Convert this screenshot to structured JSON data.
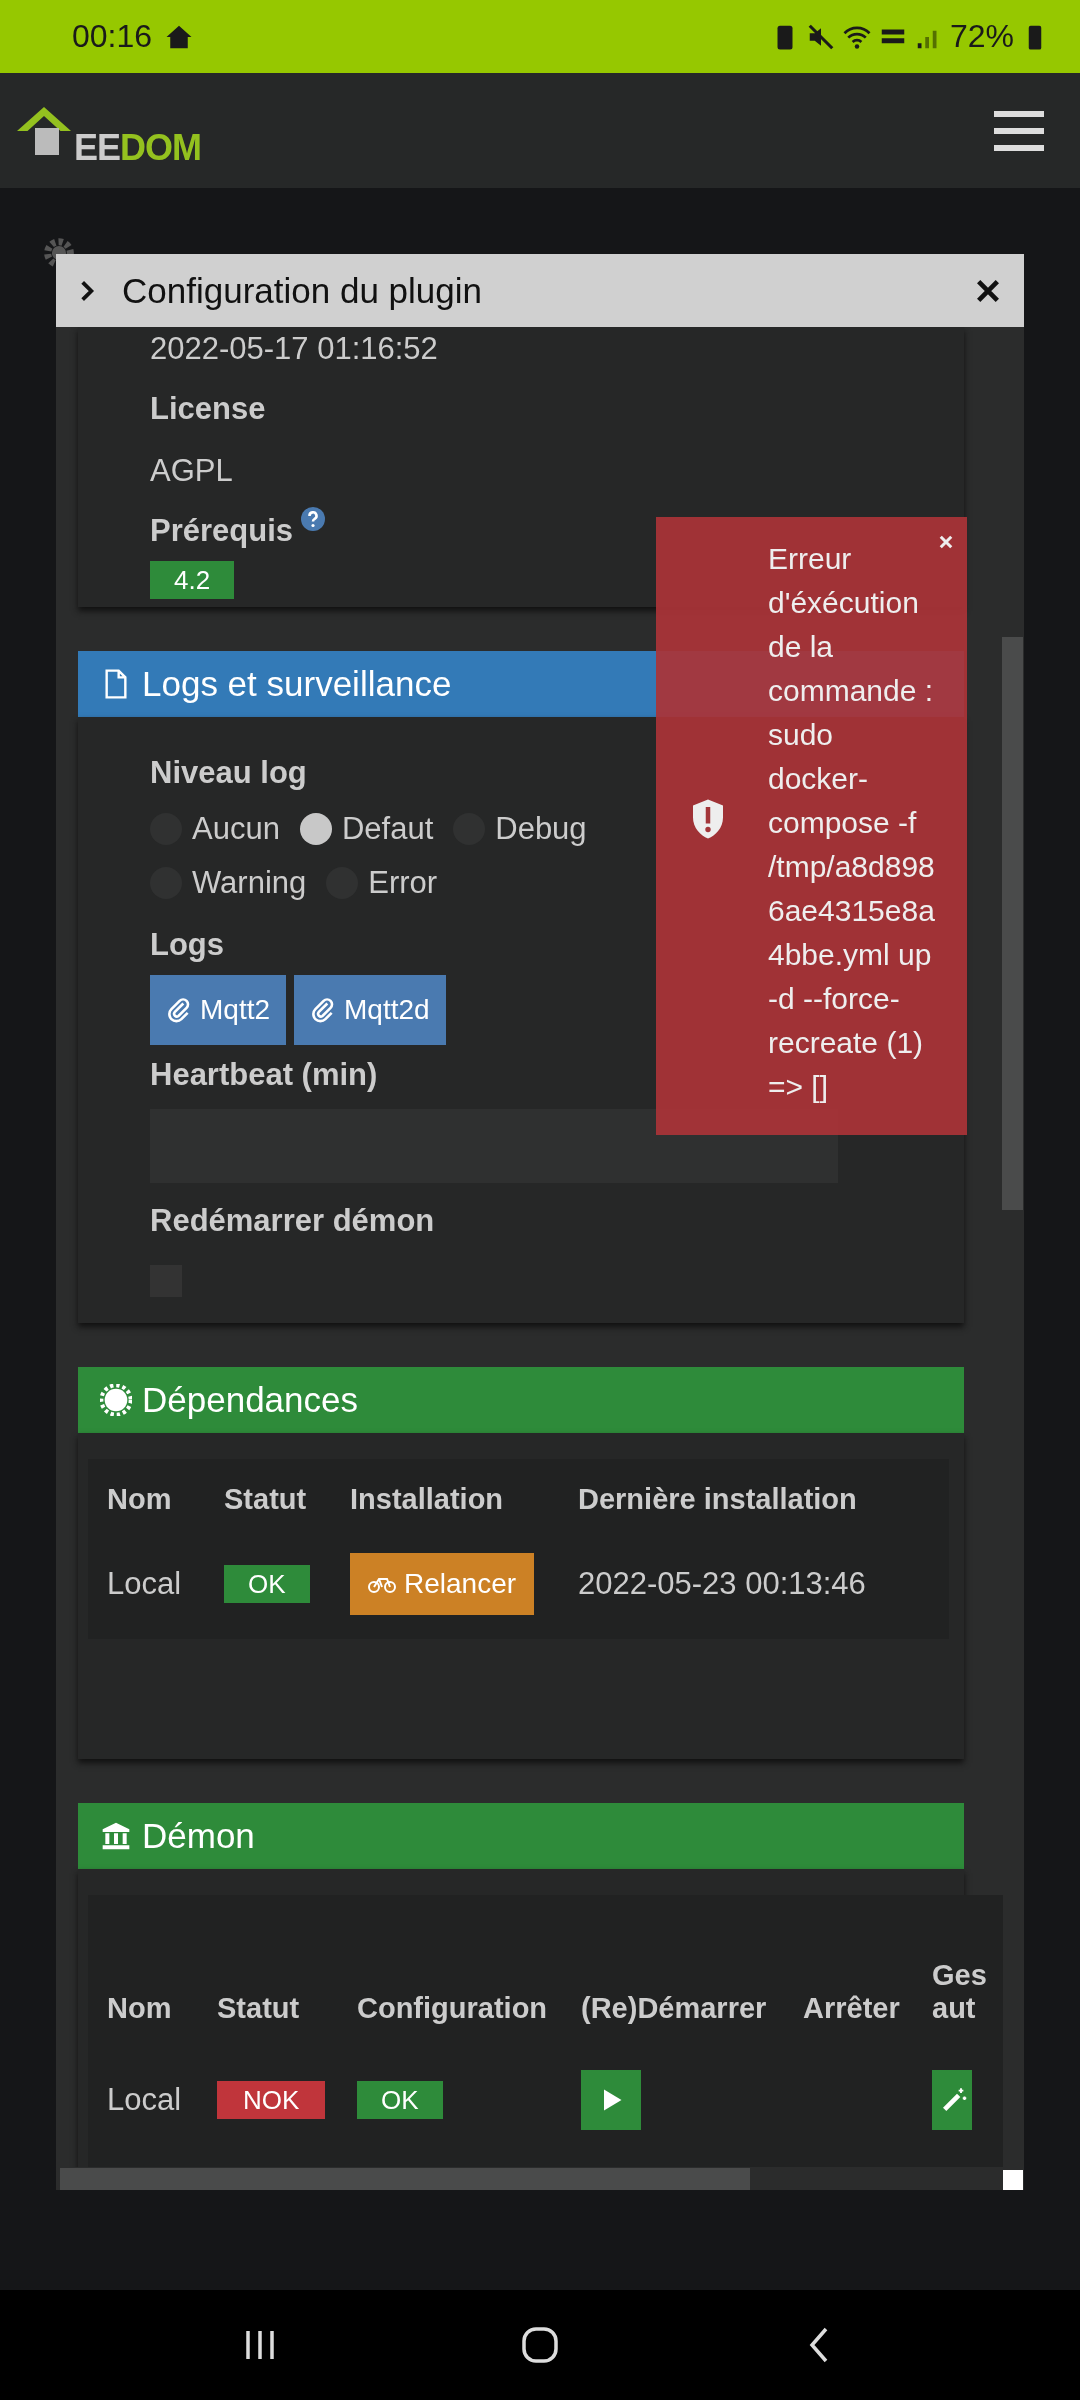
{
  "status_bar": {
    "time": "00:16",
    "battery": "72%"
  },
  "app_header": {
    "logo_light": "EE",
    "logo_accent": "DOM"
  },
  "modal": {
    "title": "Configuration du plugin",
    "date": "2022-05-17 01:16:52",
    "license_label": "License",
    "license": "AGPL",
    "prereq_label": "Prérequis",
    "prereq_badge": "4.2",
    "logs_section": {
      "title": "Logs et surveillance",
      "level_label": "Niveau log",
      "levels": [
        {
          "label": "Aucun",
          "selected": false
        },
        {
          "label": "Defaut",
          "selected": true
        },
        {
          "label": "Debug",
          "selected": false
        },
        {
          "label": "Warning",
          "selected": false
        },
        {
          "label": "Error",
          "selected": false
        }
      ],
      "logs_label": "Logs",
      "log_buttons": [
        "Mqtt2",
        "Mqtt2d"
      ],
      "heartbeat_label": "Heartbeat (min)",
      "restart_label": "Redémarrer démon",
      "restart_checked": false
    },
    "dependencies": {
      "title": "Dépendances",
      "columns": [
        "Nom",
        "Statut",
        "Installation",
        "Dernière installation"
      ],
      "rows": [
        {
          "name": "Local",
          "status": "OK",
          "status_ok": true,
          "action": "Relancer",
          "last": "2022-05-23 00:13:46"
        }
      ]
    },
    "daemon": {
      "title": "Démon",
      "columns": [
        "Nom",
        "Statut",
        "Configuration",
        "(Re)Démarrer",
        "Arrêter",
        "Ges aut"
      ],
      "rows": [
        {
          "name": "Local",
          "status": "NOK",
          "status_ok": false,
          "config": "OK",
          "config_ok": true
        }
      ]
    }
  },
  "toast": {
    "message": "Erreur d'éxécution de la commande : sudo docker-compose -f /tmp/a8d8986ae4315e8a4bbe.yml up -d --force-recreate (1) => []"
  }
}
